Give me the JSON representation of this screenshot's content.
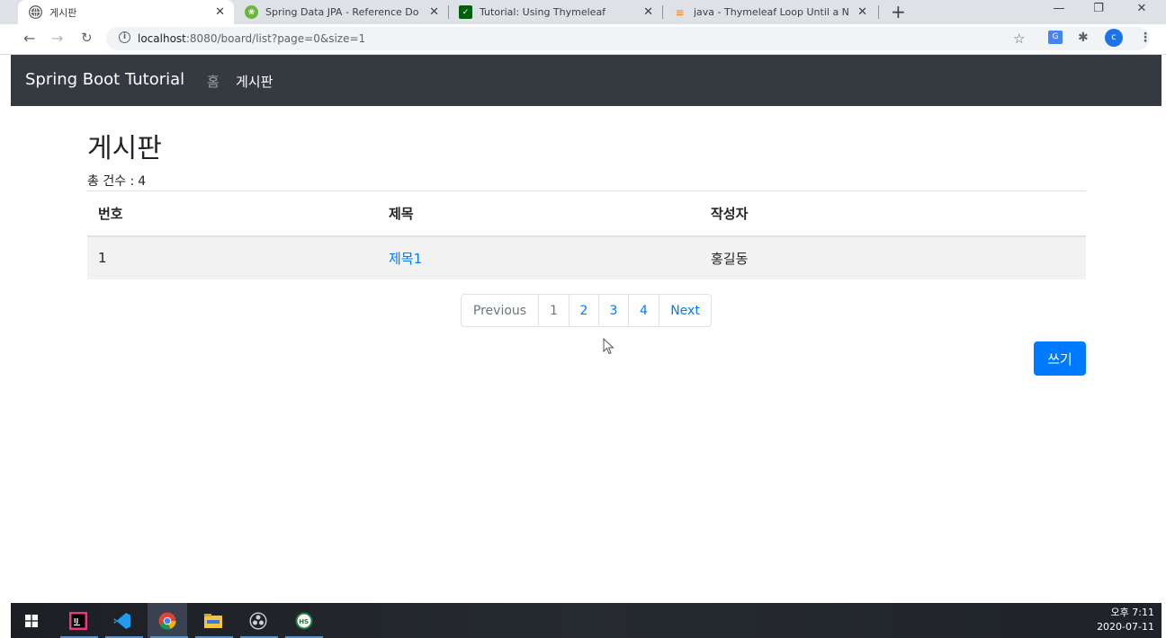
{
  "browser": {
    "tabs": [
      {
        "title": "게시판",
        "icon": "globe-icon"
      },
      {
        "title": "Spring Data JPA - Reference Do",
        "icon": "spring-icon"
      },
      {
        "title": "Tutorial: Using Thymeleaf",
        "icon": "thymeleaf-icon"
      },
      {
        "title": "java - Thymeleaf Loop Until a N",
        "icon": "stackoverflow-icon"
      }
    ],
    "new_tab_label": "+",
    "url_host": "localhost",
    "url_rest": ":8080/board/list?page=0&size=1",
    "profile_initial": "c"
  },
  "navbar": {
    "brand": "Spring Boot Tutorial",
    "links": [
      {
        "label": "홈",
        "active": false
      },
      {
        "label": "게시판",
        "active": true
      }
    ]
  },
  "main": {
    "title": "게시판",
    "total_label": "총 건수 :",
    "total_value": "4",
    "table": {
      "headers": [
        "번호",
        "제목",
        "작성자"
      ],
      "rows": [
        {
          "no": "1",
          "title": "제목1",
          "author": "홍길동"
        }
      ]
    },
    "pagination": {
      "previous": "Previous",
      "pages": [
        "1",
        "2",
        "3",
        "4"
      ],
      "next": "Next"
    },
    "write_button": "쓰기"
  },
  "taskbar": {
    "apps": [
      "windows-start-icon",
      "intellij-icon",
      "vscode-icon",
      "chrome-icon",
      "file-explorer-icon",
      "obs-icon",
      "hs-app-icon"
    ],
    "time": "오후 7:11",
    "date": "2020-07-11"
  },
  "colors": {
    "navbar_bg": "#343a40",
    "primary": "#007bff",
    "tab_strip": "#dee1e6"
  }
}
